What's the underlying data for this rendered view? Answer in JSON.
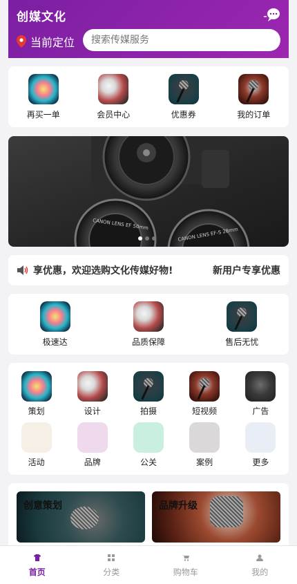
{
  "header": {
    "brand": "创媒文化",
    "location_label": "当前定位",
    "search_placeholder": "搜索传媒服务",
    "icons": [
      "chat-icon",
      "location-pin-icon"
    ]
  },
  "quick_links": [
    {
      "label": "再买一单",
      "icon": "aurora-thumbnail"
    },
    {
      "label": "会员中心",
      "icon": "concert-thumbnail"
    },
    {
      "label": "优惠券",
      "icon": "microphone-thumbnail"
    },
    {
      "label": "我的订单",
      "icon": "microphone-thumbnail"
    }
  ],
  "banner": {
    "slide_count": 3,
    "active_slide": 1,
    "lens_texts": [
      "CANON LENS EF 50mm",
      "CANON LENS EF-S 28mm"
    ]
  },
  "notice": {
    "text": "享优惠，欢迎选购文化传媒好物!",
    "link": "新用户专享优惠",
    "icon": "speaker-icon"
  },
  "features": [
    {
      "label": "极速达"
    },
    {
      "label": "品质保障"
    },
    {
      "label": "售后无忧"
    }
  ],
  "categories_row1": [
    {
      "label": "策划"
    },
    {
      "label": "设计"
    },
    {
      "label": "拍摄"
    },
    {
      "label": "短视频"
    },
    {
      "label": "广告"
    }
  ],
  "categories_row2": [
    {
      "label": "活动",
      "color": "#f5efe6"
    },
    {
      "label": "品牌",
      "color": "#efd9ec"
    },
    {
      "label": "公关",
      "color": "#c9efdf"
    },
    {
      "label": "案例",
      "color": "#dbd8da"
    },
    {
      "label": "更多",
      "color": "#e8edf6"
    }
  ],
  "promos": [
    {
      "title": "创意策划"
    },
    {
      "title": "品牌升级"
    }
  ],
  "tabbar": [
    {
      "label": "首页",
      "icon": "shirt-icon",
      "active": true
    },
    {
      "label": "分类",
      "icon": "grid-icon",
      "active": false
    },
    {
      "label": "购物车",
      "icon": "cart-icon",
      "active": false
    },
    {
      "label": "我的",
      "icon": "user-icon",
      "active": false
    }
  ],
  "colors": {
    "primary": "#7b1fa2",
    "background": "#f3f3f5"
  }
}
